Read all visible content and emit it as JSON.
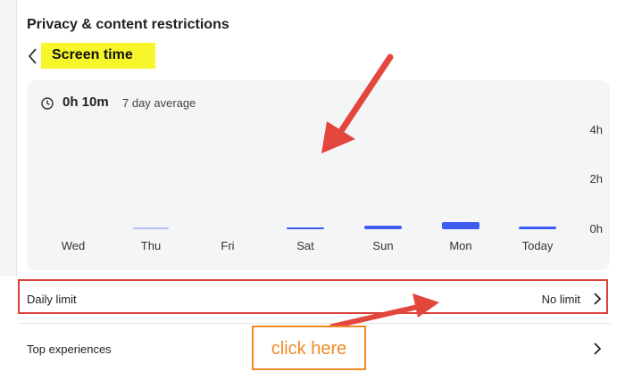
{
  "header": {
    "title": "Privacy & content restrictions",
    "screen_title": "Screen time",
    "highlight_color": "#f6f62a"
  },
  "summary": {
    "value": "0h 10m",
    "label": "7 day average",
    "icon": "clock-icon"
  },
  "chart_data": {
    "type": "bar",
    "categories": [
      "Wed",
      "Thu",
      "Fri",
      "Sat",
      "Sun",
      "Mon",
      "Today"
    ],
    "values_minutes": [
      0,
      1,
      0,
      3,
      8,
      17,
      6
    ],
    "y_ticks": [
      "4h",
      "2h",
      "0h"
    ],
    "ylim_minutes": [
      0,
      240
    ],
    "bar_color": "#3b5bf2",
    "grid": false
  },
  "rows": {
    "daily_limit": {
      "label": "Daily limit",
      "value": "No limit"
    },
    "top_experiences": {
      "label": "Top experiences"
    }
  },
  "annotations": {
    "callout": "click here",
    "arrow_color": "#e2463c",
    "callout_color": "#f08a24"
  }
}
